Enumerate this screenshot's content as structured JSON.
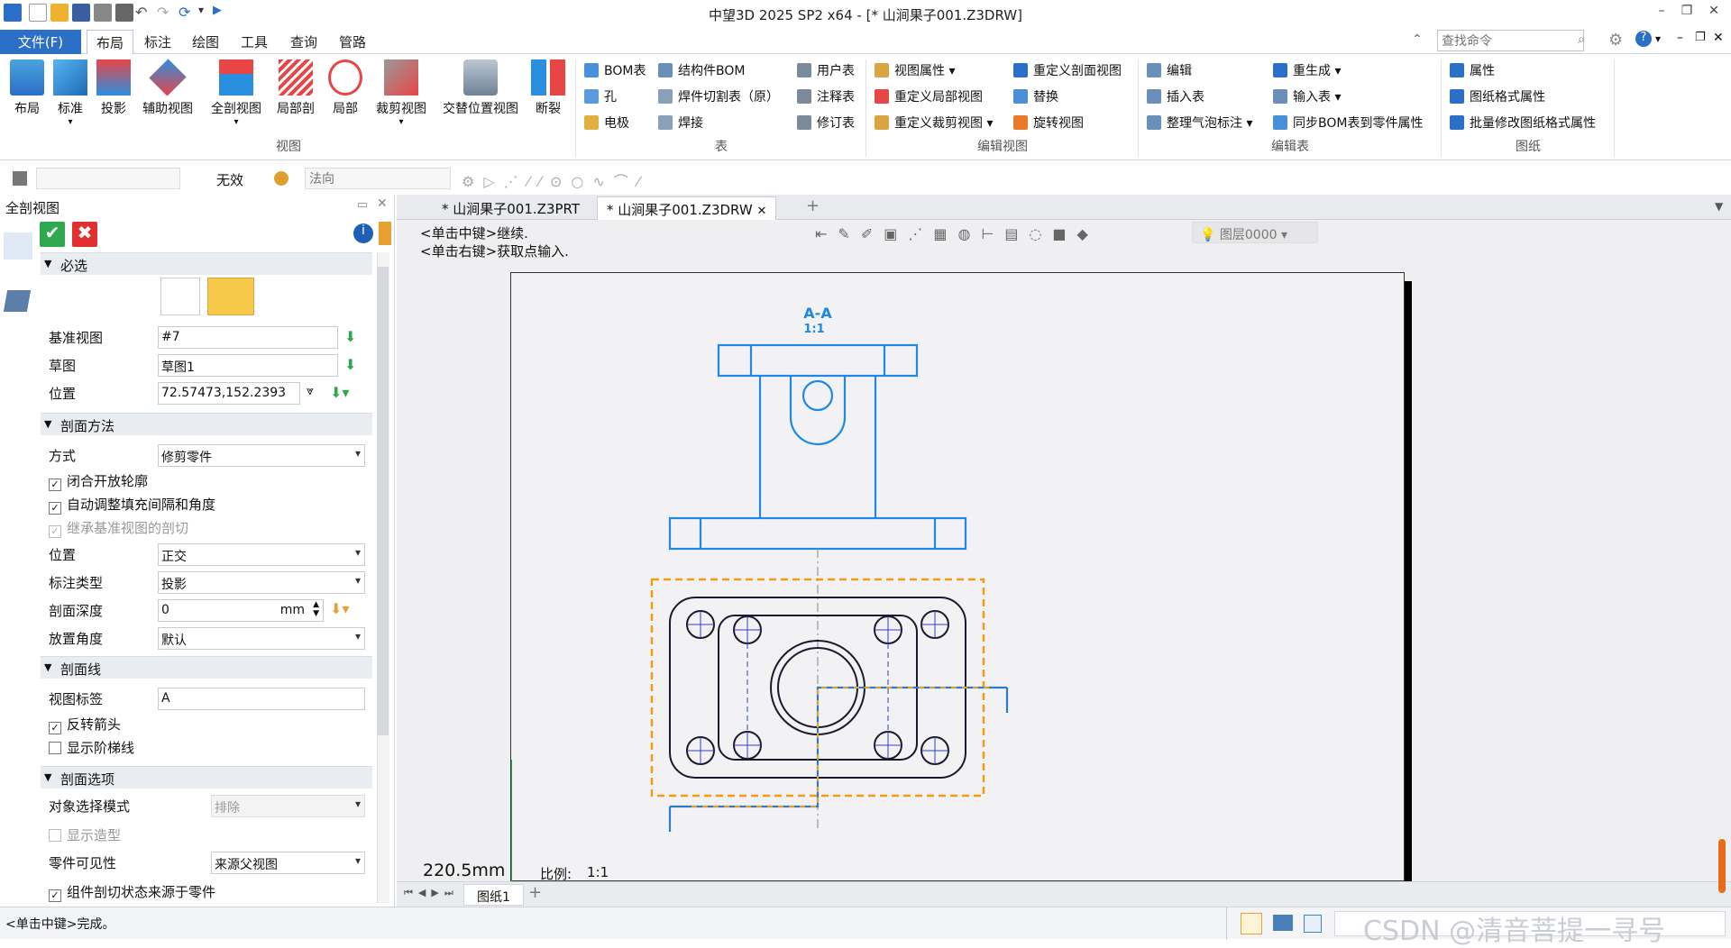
{
  "app": {
    "title": "中望3D 2025 SP2 x64 - [* 山涧果子001.Z3DRW]"
  },
  "menu": {
    "file": "文件(F)",
    "tabs": [
      "布局",
      "标注",
      "绘图",
      "工具",
      "查询",
      "管路"
    ],
    "search_placeholder": "查找命令"
  },
  "ribbon": {
    "view_big": [
      "布局",
      "标准",
      "投影",
      "辅助视图",
      "全剖视图",
      "局部剖",
      "局部",
      "裁剪视图",
      "交替位置视图",
      "断裂"
    ],
    "view_group": "视图",
    "table_col1": [
      "BOM表",
      "孔",
      "电极"
    ],
    "table_col2": [
      "结构件BOM",
      "焊件切割表（原）",
      "焊接"
    ],
    "table_col3": [
      "用户表",
      "注释表",
      "修订表"
    ],
    "table_group": "表",
    "editview_col1": [
      "视图属性",
      "重定义局部视图",
      "重定义裁剪视图"
    ],
    "editview_col2": [
      "重定义剖面视图",
      "替换",
      "旋转视图"
    ],
    "editview_group": "编辑视图",
    "edittable_col1": [
      "编辑",
      "插入表",
      "整理气泡标注"
    ],
    "edittable_col2": [
      "重生成",
      "输入表",
      "同步BOM表到零件属性"
    ],
    "edittable_group": "编辑表",
    "sheet_col": [
      "属性",
      "图纸格式属性",
      "批量修改图纸格式属性"
    ],
    "sheet_group": "图纸"
  },
  "toolbar2": {
    "invalid": "无效",
    "normal_placeholder": "法向"
  },
  "panel": {
    "title": "全剖视图",
    "required": "必选",
    "base_view_label": "基准视图",
    "base_view_value": "#7",
    "sketch_label": "草图",
    "sketch_value": "草图1",
    "position_label": "位置",
    "position_value": "72.57473,152.2393",
    "method_section": "剖面方法",
    "mode_label": "方式",
    "mode_value": "修剪零件",
    "chk_close": "闭合开放轮廓",
    "chk_auto": "自动调整填充间隔和角度",
    "chk_inherit": "继承基准视图的剖切",
    "pos2_label": "位置",
    "pos2_value": "正交",
    "anno_label": "标注类型",
    "anno_value": "投影",
    "depth_label": "剖面深度",
    "depth_value": "0",
    "depth_unit": "mm",
    "angle_label": "放置角度",
    "angle_value": "默认",
    "line_section": "剖面线",
    "view_label_label": "视图标签",
    "view_label_value": "A",
    "chk_reverse": "反转箭头",
    "chk_step": "显示阶梯线",
    "options_section": "剖面选项",
    "select_mode_label": "对象选择模式",
    "select_mode_value": "排除",
    "chk_show_shape": "显示造型",
    "part_vis_label": "零件可见性",
    "part_vis_value": "来源父视图",
    "chk_component": "组件剖切状态来源于零件"
  },
  "doc_tabs": [
    "* 山涧果子001.Z3PRT",
    "* 山涧果子001.Z3DRW"
  ],
  "canvas": {
    "hint1": "<单击中键>继续.",
    "hint2": "<单击右键>获取点输入.",
    "layer": "图层0000",
    "size_readout": "220.5mm",
    "scale_label": "比例:",
    "scale_value": "1:1",
    "section_tag": "A-A",
    "section_scale": "1:1",
    "sheet_tab": "图纸1"
  },
  "status": {
    "message": "<单击中键>完成。",
    "watermark": "CSDN @清音菩提一寻号"
  },
  "colors": {
    "accent": "#2b6fc7",
    "blue_geom": "#1e88e5",
    "dark_geom": "#1a1a2e",
    "select_orange": "#f39c12"
  }
}
